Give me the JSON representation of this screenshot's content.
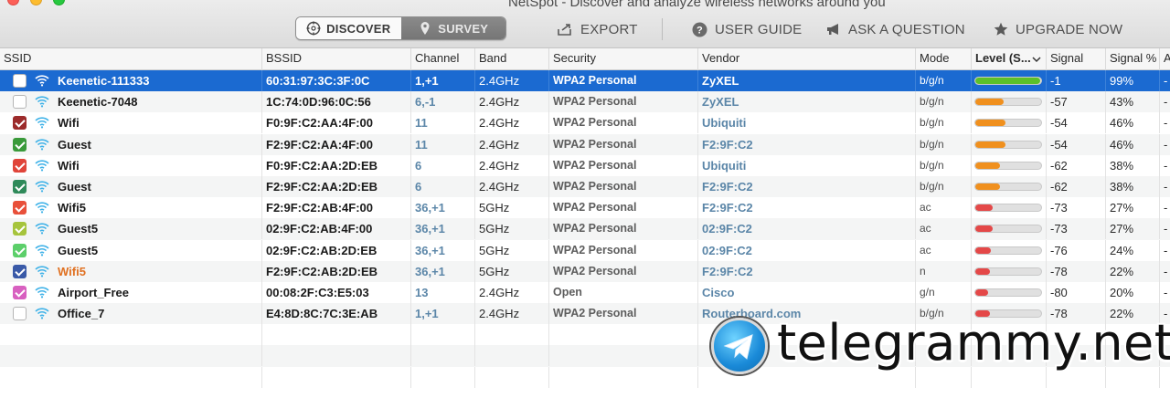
{
  "window": {
    "title": "NetSpot - Discover and analyze wireless networks around you"
  },
  "toolbar": {
    "discover_label": "DISCOVER",
    "survey_label": "SURVEY",
    "export_label": "EXPORT",
    "guide_label": "USER GUIDE",
    "ask_label": "ASK A QUESTION",
    "upgrade_label": "UPGRADE NOW"
  },
  "table": {
    "columns": [
      "SSID",
      "BSSID",
      "Channel",
      "Band",
      "Security",
      "Vendor",
      "Mode",
      "Level (S...",
      "Signal",
      "Signal %",
      "A"
    ],
    "rows": [
      {
        "checked": false,
        "check_color": "#ffffff",
        "ssid": "Keenetic-111333",
        "bssid": "60:31:97:3C:3F:0C",
        "channel": "1,+1",
        "band": "2.4GHz",
        "security": "WPA2 Personal",
        "vendor": "ZyXEL",
        "mode": "b/g/n",
        "level_pct": 99,
        "level_color": "#5cc02a",
        "signal": "-1",
        "signal_pct": "99%",
        "a": "-"
      },
      {
        "checked": false,
        "check_color": "#ffffff",
        "ssid": "Keenetic-7048",
        "bssid": "1C:74:0D:96:0C:56",
        "channel": "6,-1",
        "band": "2.4GHz",
        "security": "WPA2 Personal",
        "vendor": "ZyXEL",
        "mode": "b/g/n",
        "level_pct": 43,
        "level_color": "#f0901e",
        "signal": "-57",
        "signal_pct": "43%",
        "a": "-"
      },
      {
        "checked": true,
        "check_color": "#9c2b2b",
        "ssid": "Wifi",
        "bssid": "F0:9F:C2:AA:4F:00",
        "channel": "11",
        "band": "2.4GHz",
        "security": "WPA2 Personal",
        "vendor": "Ubiquiti",
        "mode": "b/g/n",
        "level_pct": 46,
        "level_color": "#f0901e",
        "signal": "-54",
        "signal_pct": "46%",
        "a": "-"
      },
      {
        "checked": true,
        "check_color": "#3a9a3a",
        "ssid": "Guest",
        "bssid": "F2:9F:C2:AA:4F:00",
        "channel": "11",
        "band": "2.4GHz",
        "security": "WPA2 Personal",
        "vendor": "F2:9F:C2",
        "mode": "b/g/n",
        "level_pct": 46,
        "level_color": "#f0901e",
        "signal": "-54",
        "signal_pct": "46%",
        "a": "-"
      },
      {
        "checked": true,
        "check_color": "#e0453a",
        "ssid": "Wifi",
        "bssid": "F0:9F:C2:AA:2D:EB",
        "channel": "6",
        "band": "2.4GHz",
        "security": "WPA2 Personal",
        "vendor": "Ubiquiti",
        "mode": "b/g/n",
        "level_pct": 38,
        "level_color": "#f0901e",
        "signal": "-62",
        "signal_pct": "38%",
        "a": "-"
      },
      {
        "checked": true,
        "check_color": "#2f8a5a",
        "ssid": "Guest",
        "bssid": "F2:9F:C2:AA:2D:EB",
        "channel": "6",
        "band": "2.4GHz",
        "security": "WPA2 Personal",
        "vendor": "F2:9F:C2",
        "mode": "b/g/n",
        "level_pct": 38,
        "level_color": "#f0901e",
        "signal": "-62",
        "signal_pct": "38%",
        "a": "-"
      },
      {
        "checked": true,
        "check_color": "#e8503a",
        "ssid": "Wifi5",
        "bssid": "F2:9F:C2:AB:4F:00",
        "channel": "36,+1",
        "band": "5GHz",
        "security": "WPA2 Personal",
        "vendor": "F2:9F:C2",
        "mode": "ac",
        "level_pct": 27,
        "level_color": "#e44848",
        "signal": "-73",
        "signal_pct": "27%",
        "a": "-"
      },
      {
        "checked": true,
        "check_color": "#a6c43c",
        "ssid": "Guest5",
        "bssid": "02:9F:C2:AB:4F:00",
        "channel": "36,+1",
        "band": "5GHz",
        "security": "WPA2 Personal",
        "vendor": "02:9F:C2",
        "mode": "ac",
        "level_pct": 27,
        "level_color": "#e44848",
        "signal": "-73",
        "signal_pct": "27%",
        "a": "-"
      },
      {
        "checked": true,
        "check_color": "#5ccf6a",
        "ssid": "Guest5",
        "bssid": "02:9F:C2:AB:2D:EB",
        "channel": "36,+1",
        "band": "5GHz",
        "security": "WPA2 Personal",
        "vendor": "02:9F:C2",
        "mode": "ac",
        "level_pct": 24,
        "level_color": "#e44848",
        "signal": "-76",
        "signal_pct": "24%",
        "a": "-"
      },
      {
        "checked": true,
        "check_color": "#3a5aa8",
        "ssid": "Wifi5",
        "ssid_color": "#e07020",
        "bssid": "F2:9F:C2:AB:2D:EB",
        "channel": "36,+1",
        "band": "5GHz",
        "security": "WPA2 Personal",
        "vendor": "F2:9F:C2",
        "mode": "n",
        "level_pct": 22,
        "level_color": "#e44848",
        "signal": "-78",
        "signal_pct": "22%",
        "a": "-"
      },
      {
        "checked": true,
        "check_color": "#d860c0",
        "ssid": "Airport_Free",
        "bssid": "00:08:2F:C3:E5:03",
        "channel": "13",
        "band": "2.4GHz",
        "security": "Open",
        "vendor": "Cisco",
        "mode": "g/n",
        "level_pct": 20,
        "level_color": "#e44848",
        "signal": "-80",
        "signal_pct": "20%",
        "a": "-"
      },
      {
        "checked": false,
        "check_color": "#ffffff",
        "ssid": "Office_7",
        "bssid": "E4:8D:8C:7C:3E:AB",
        "channel": "1,+1",
        "band": "2.4GHz",
        "security": "WPA2 Personal",
        "vendor": "Routerboard.com",
        "mode": "b/g/n",
        "level_pct": 22,
        "level_color": "#e44848",
        "signal": "-78",
        "signal_pct": "22%",
        "a": "-"
      }
    ]
  },
  "watermark": {
    "text": "telegrammy.net"
  },
  "colors": {
    "selection": "#1b6ad1",
    "link_blue": "#5b86a8"
  }
}
